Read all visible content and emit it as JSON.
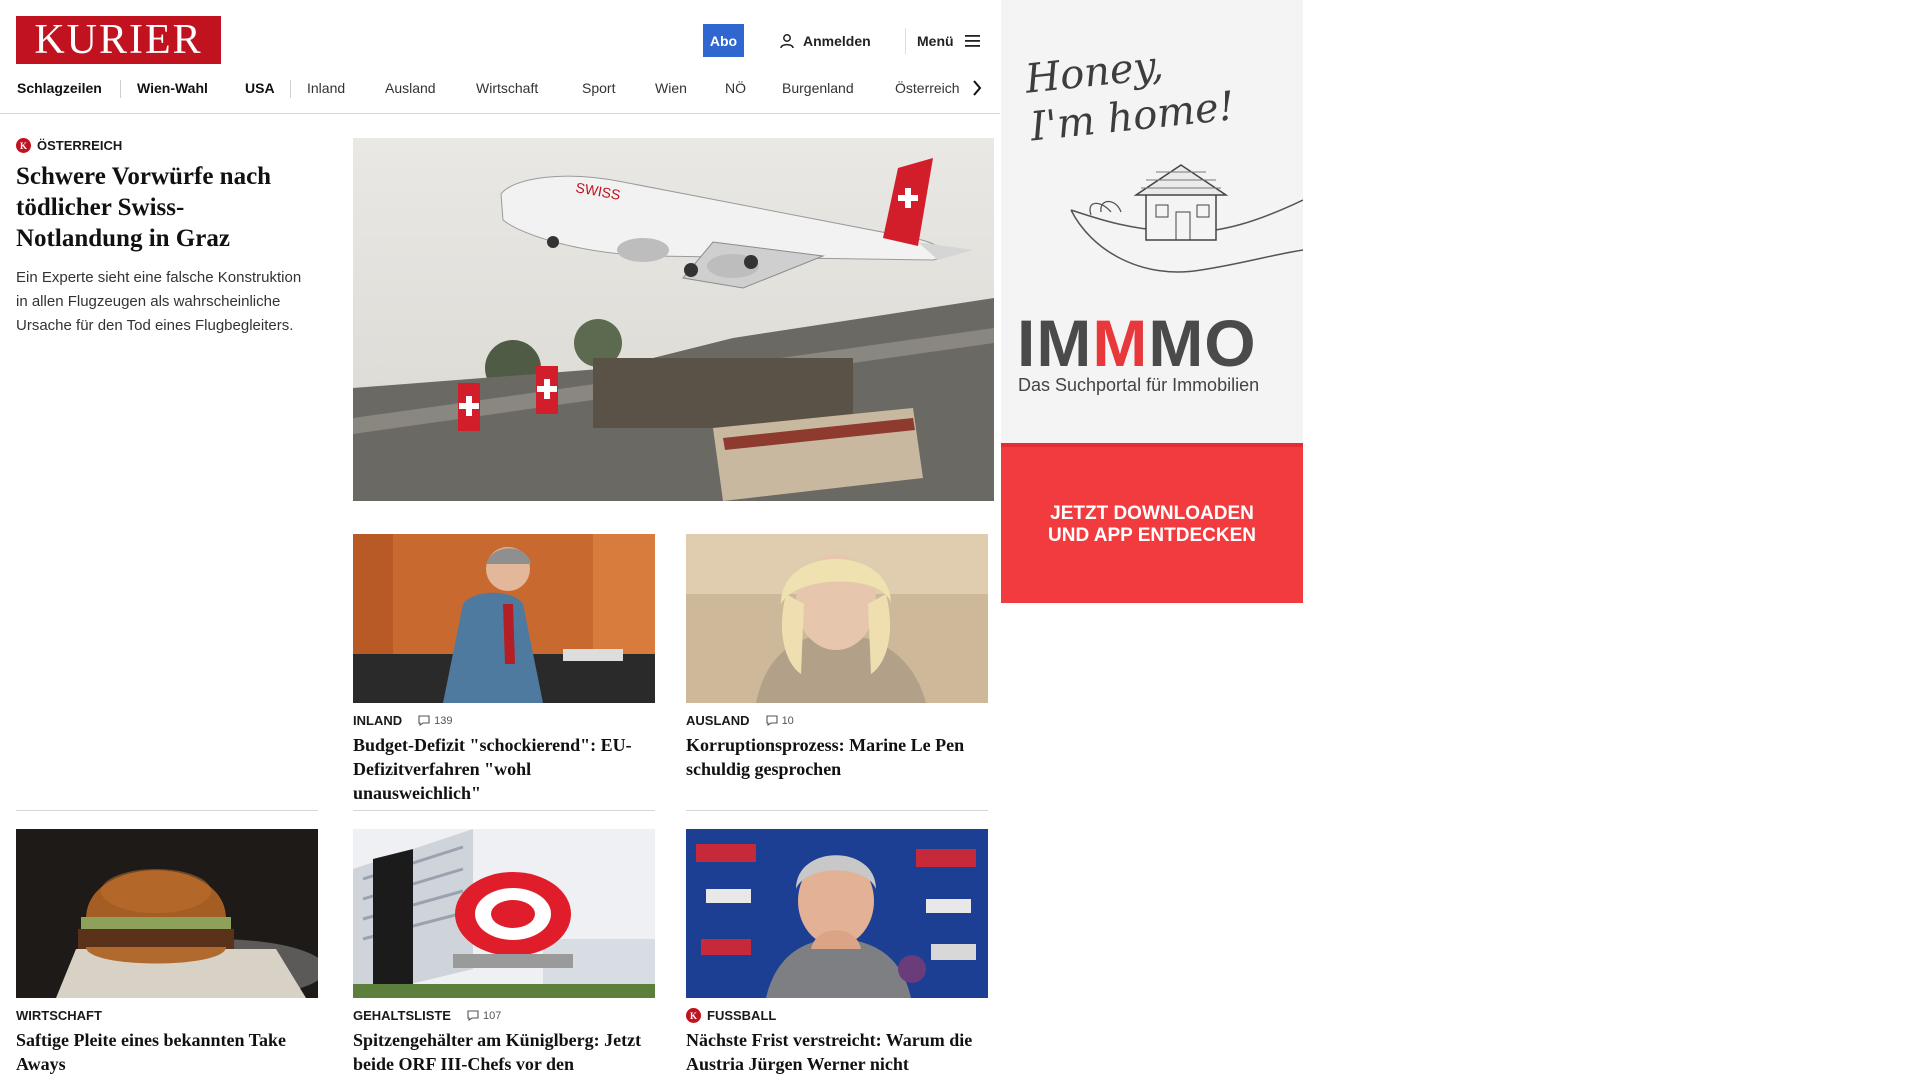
{
  "brand": {
    "logo_text": "KURIER",
    "color": "#c1121f"
  },
  "header": {
    "abo_label": "Abo",
    "login_label": "Anmelden",
    "menu_label": "Menü"
  },
  "nav": {
    "items": [
      {
        "label": "Schlagzeilen"
      },
      {
        "label": "Wien-Wahl"
      },
      {
        "label": "USA"
      },
      {
        "label": "Inland"
      },
      {
        "label": "Ausland"
      },
      {
        "label": "Wirtschaft"
      },
      {
        "label": "Sport"
      },
      {
        "label": "Wien"
      },
      {
        "label": "NÖ"
      },
      {
        "label": "Burgenland"
      },
      {
        "label": "Österreich"
      }
    ]
  },
  "lead": {
    "kicker": "ÖSTERREICH",
    "headline": "Schwere Vorwürfe nach tödlicher Swiss-Notlandung in Graz",
    "teaser": "Ein Experte sieht eine falsche Konstruktion in allen Flugzeugen als wahrscheinliche Ursache für den Tod eines Flugbegleiters."
  },
  "articles": [
    {
      "kicker": "INLAND",
      "comments": "139",
      "headline": "Budget-Defizit \"schockierend\": EU-Defizitverfahren \"wohl unausweichlich\""
    },
    {
      "kicker": "AUSLAND",
      "comments": "10",
      "headline": "Korruptionsprozess: Marine Le Pen schuldig gesprochen"
    },
    {
      "kicker": "WIRTSCHAFT",
      "headline": "Saftige Pleite eines bekannten Take Aways"
    },
    {
      "kicker": "GEHALTSLISTE",
      "comments": "107",
      "headline": "Spitzengehälter am Küniglberg: Jetzt beide ORF III-Chefs vor den Direktoren"
    },
    {
      "kicker": "FUSSBALL",
      "headline": "Nächste Frist verstreicht: Warum die Austria Jürgen Werner nicht auszahlen kann"
    }
  ],
  "ad": {
    "script_text": "Honey,\nI'm home!",
    "brand_part1": "IM",
    "brand_part2": "M",
    "brand_part3": "MO",
    "tagline": "Das Suchportal für Immobilien",
    "cta": "JETZT DOWNLOADEN\nUND APP ENTDECKEN",
    "accent_color": "#f23b3f"
  }
}
